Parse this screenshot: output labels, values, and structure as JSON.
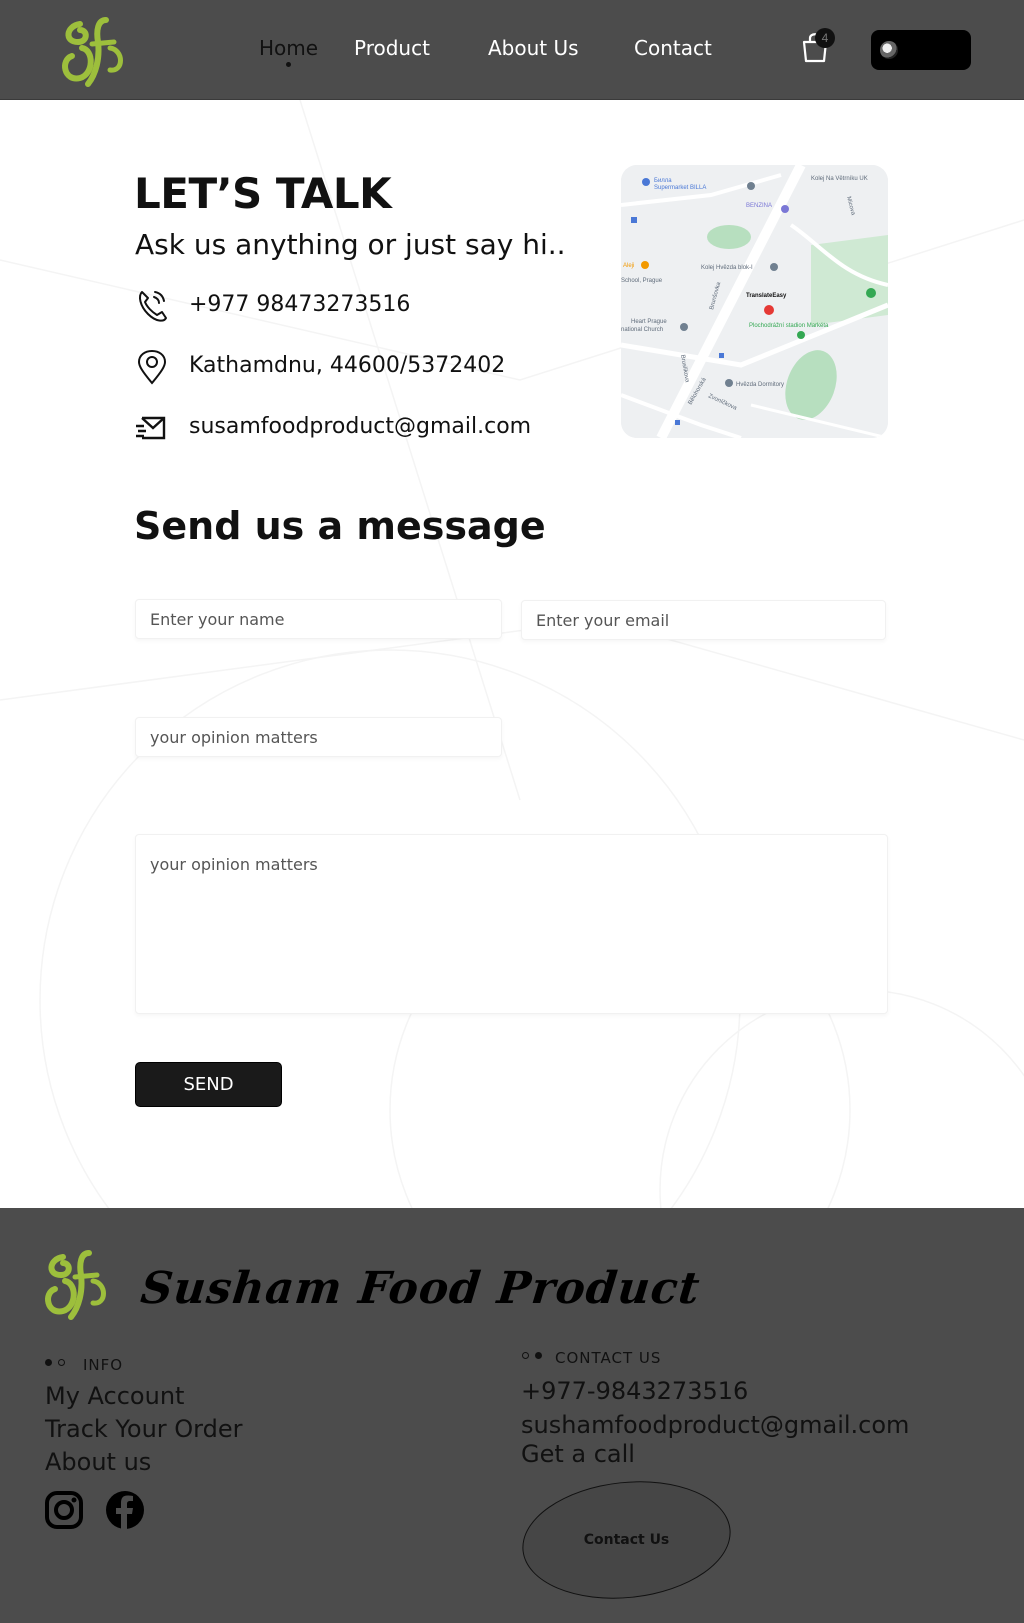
{
  "header": {
    "nav": [
      {
        "label": "Home",
        "active": true
      },
      {
        "label": "Product"
      },
      {
        "label": "About Us"
      },
      {
        "label": "Contact"
      }
    ],
    "cart_count": "4",
    "icons": {
      "logo": "sf-logo",
      "cart": "shopping-bag-icon",
      "avatar": "user-avatar"
    }
  },
  "contact": {
    "heading": "LET’S TALK",
    "subtitle": "Ask us anything or just say hi..",
    "phone": "+977 98473273516",
    "address": "Kathamdnu, 44600/5372402",
    "email": "susamfoodproduct@gmail.com",
    "icons": [
      "phone-icon",
      "location-pin-icon",
      "mail-icon"
    ]
  },
  "map": {
    "labels": [
      "Kolej Na Větrníku UK",
      "Билла",
      "Supermarket BILLA",
      "BENZINA",
      "Kolej Hvězda blok-I",
      "TranslateEasy",
      "School, Prague",
      "Heart Prague",
      "national Church",
      "Plochodrážní stadion Markéta",
      "Hvězda Dormitory",
      "Brunšovka",
      "Bělohorská",
      "Zvoníčkova",
      "Aleji",
      "Micova",
      "Bruslíkova"
    ]
  },
  "form": {
    "heading": "Send us a message",
    "name_placeholder": "Enter your name",
    "email_placeholder": "Enter your email",
    "opinion_placeholder": "your opinion matters",
    "message_placeholder": "your opinion matters",
    "send_label": "SEND"
  },
  "footer": {
    "brand": "Susham Food Product",
    "info_heading": "INFO",
    "info_links": [
      "My Account",
      "Track Your Order",
      "About us"
    ],
    "contact_heading": "CONTACT US",
    "phone": "+977-9843273516",
    "email": "sushamfoodproduct@gmail.com",
    "call": "Get a call",
    "contact_button": "Contact Us",
    "social": [
      "instagram-icon",
      "facebook-icon"
    ]
  },
  "colors": {
    "header_bg": "#4c4c4c",
    "logo_green": "#9dbf3c",
    "button_bg": "#1a1a1a"
  }
}
